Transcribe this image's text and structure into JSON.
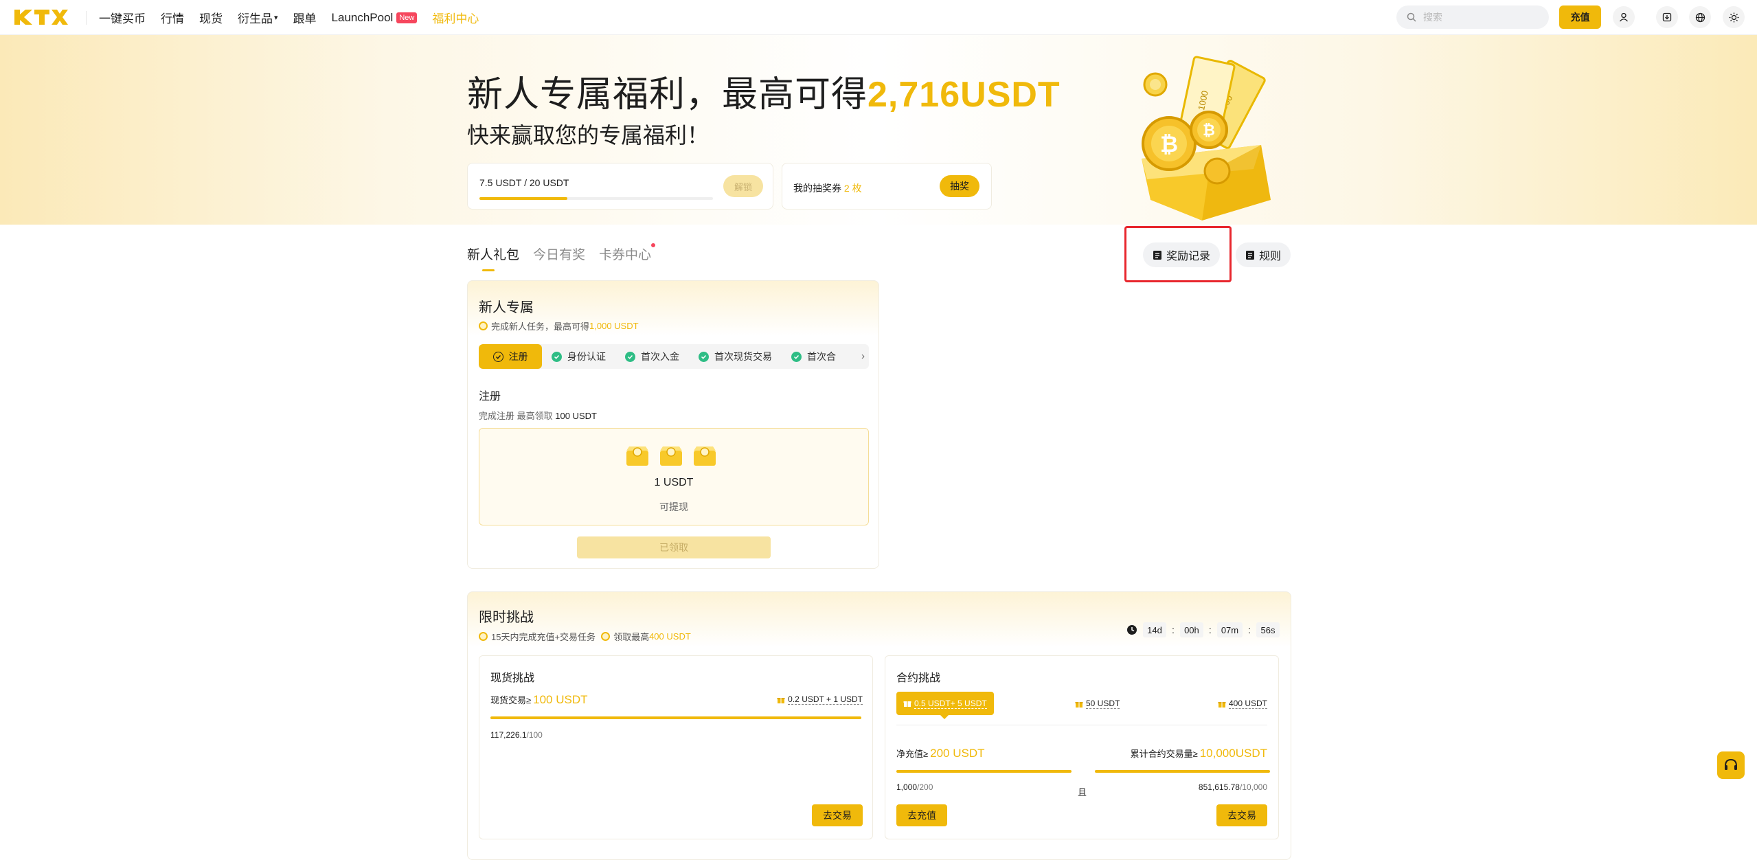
{
  "nav": {
    "logo_text": "KTX",
    "items": [
      {
        "label": "一键买币"
      },
      {
        "label": "行情"
      },
      {
        "label": "现货"
      },
      {
        "label": "衍生品",
        "caret": "▾"
      },
      {
        "label": "跟单"
      },
      {
        "label": "LaunchPool",
        "badge": "New"
      },
      {
        "label": "福利中心",
        "active": true
      }
    ],
    "search_placeholder": "搜索",
    "deposit_label": "充值",
    "icons": [
      "user-icon",
      "download-icon",
      "globe-icon",
      "theme-sun-icon"
    ]
  },
  "hero": {
    "title_prefix": "新人专属福利，最高可得",
    "title_amount": "2,716USDT",
    "subtitle": "快来赢取您的专属福利！",
    "progress_label": "7.5 USDT / 20 USDT",
    "progress_fraction": 0.375,
    "unlock_label": "解锁",
    "lottery_label": "我的抽奖券",
    "lottery_count": "2 枚",
    "draw_label": "抽奖",
    "art_ticket_text": "1000"
  },
  "tabs": [
    {
      "label": "新人礼包",
      "active": true
    },
    {
      "label": "今日有奖"
    },
    {
      "label": "卡券中心",
      "dot": true
    }
  ],
  "actions": {
    "rewards_record": "奖励记录",
    "rules": "规则"
  },
  "newbie": {
    "title": "新人专属",
    "note_prefix": "完成新人任务，最高可得",
    "note_amount": "1,000 USDT",
    "steps": [
      "注册",
      "身份认证",
      "首次入金",
      "首次现货交易",
      "首次合"
    ],
    "steps_more": "›",
    "current_step_title": "注册",
    "current_step_desc_prefix": "完成注册 最高领取",
    "current_step_desc_amount": "100 USDT",
    "reward_amount": "1 USDT",
    "reward_sub": "可提现",
    "claimed_label": "已领取"
  },
  "challenge": {
    "title": "限时挑战",
    "note1": "15天内完成充值+交易任务",
    "note2_prefix": "领取最高",
    "note2_amount": "400 USDT",
    "countdown": {
      "d": "14d",
      "h": "00h",
      "m": "07m",
      "s": "56s",
      "sep": ":"
    },
    "spot": {
      "title": "现货挑战",
      "task_label": "现货交易≥",
      "task_amount": "100 USDT",
      "reward": "0.2 USDT + 1 USDT",
      "progress_current": "117,226.1",
      "progress_target": "/100",
      "progress_fraction": 1.0,
      "go_label": "去交易"
    },
    "futures": {
      "title": "合约挑战",
      "tiers": [
        "0.5 USDT+ 5 USDT",
        "50 USDT",
        "400 USDT"
      ],
      "deposit_label": "净充值≥",
      "deposit_amount": "200 USDT",
      "deposit_current": "1,000",
      "deposit_target": "/200",
      "deposit_fraction": 1.0,
      "and_label": "且",
      "volume_label": "累计合约交易量≥",
      "volume_amount": "10,000USDT",
      "volume_current": "851,615.78",
      "volume_target": "/10,000",
      "volume_fraction": 1.0,
      "go_deposit_label": "去充值",
      "go_trade_label": "去交易"
    }
  },
  "colors": {
    "brand": "#f0b90b",
    "success": "#2ebd85",
    "highlight_box": "#e8262d"
  }
}
